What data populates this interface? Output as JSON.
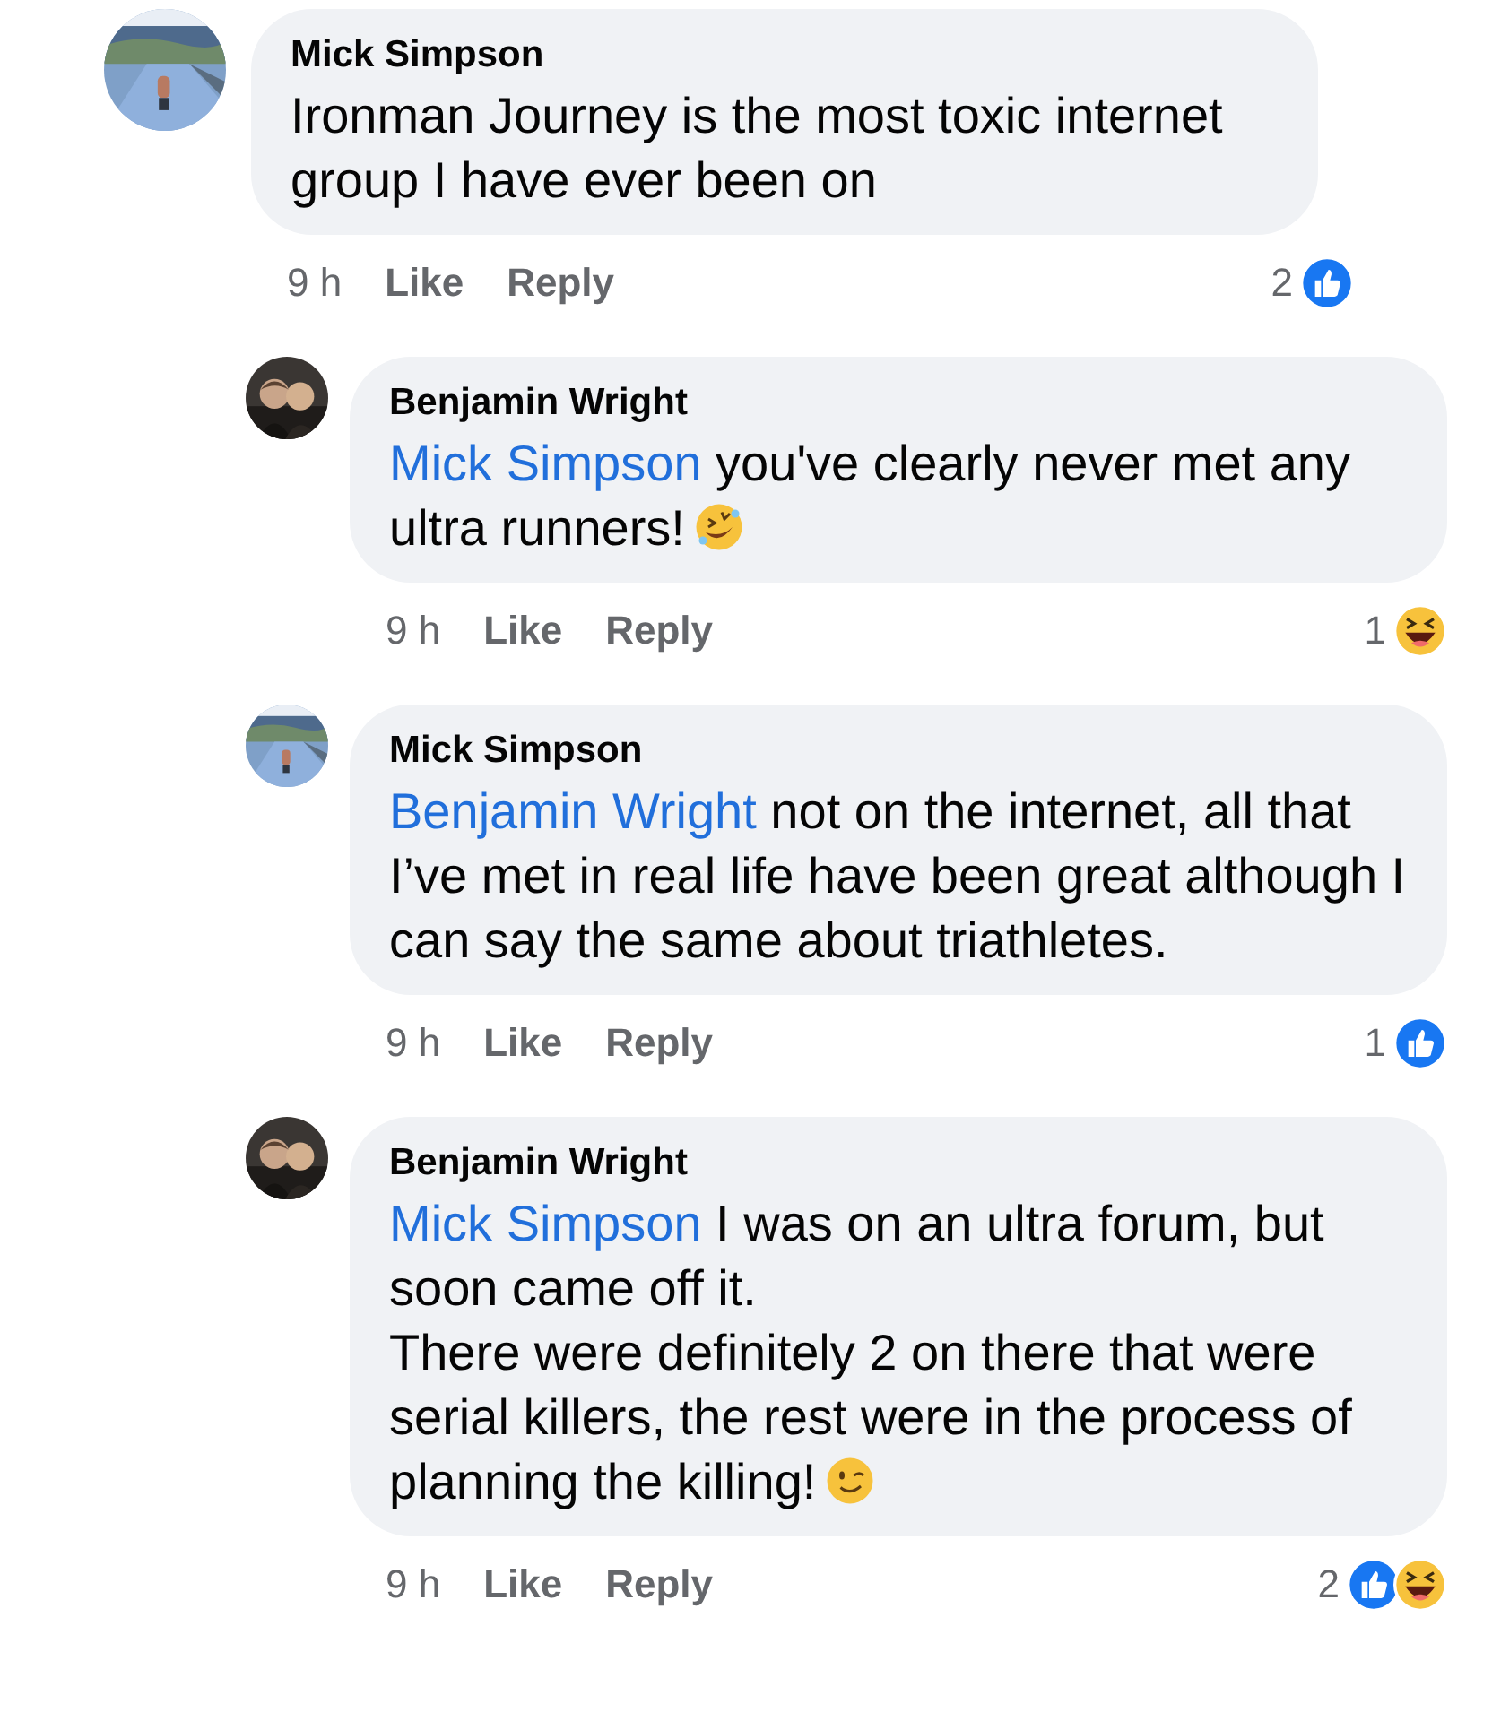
{
  "comments": [
    {
      "author": "Mick Simpson",
      "text": "Ironman Journey is the most toxic internet group I have ever been on",
      "time": "9 h",
      "actions": [
        "Like",
        "Reply"
      ],
      "reaction_count": "2",
      "reactions": [
        {
          "kind": "like"
        }
      ],
      "children": [
        {
          "author": "Benjamin Wright",
          "mention": "Mick Simpson",
          "text": " you've clearly never met any ultra runners!",
          "emoji": {
            "kind": "rofl"
          },
          "time": "9 h",
          "actions": [
            "Like",
            "Reply"
          ],
          "reaction_count": "1",
          "reactions": [
            {
              "kind": "haha"
            }
          ]
        },
        {
          "author": "Mick Simpson",
          "mention": "Benjamin Wright",
          "text": " not on the internet, all that I’ve met in real life have been great although I can say the same about triathletes.",
          "time": "9 h",
          "actions": [
            "Like",
            "Reply"
          ],
          "reaction_count": "1",
          "reactions": [
            {
              "kind": "like"
            }
          ]
        },
        {
          "author": "Benjamin Wright",
          "mention": "Mick Simpson",
          "text": " I was on an ultra forum, but soon came off it.\nThere were definitely 2 on there that were serial killers, the rest were in the process of planning the killing!",
          "emoji": {
            "kind": "wink"
          },
          "time": "9 h",
          "actions": [
            "Like",
            "Reply"
          ],
          "reaction_count": "2",
          "reactions": [
            {
              "kind": "like"
            },
            {
              "kind": "haha"
            }
          ]
        }
      ]
    }
  ]
}
